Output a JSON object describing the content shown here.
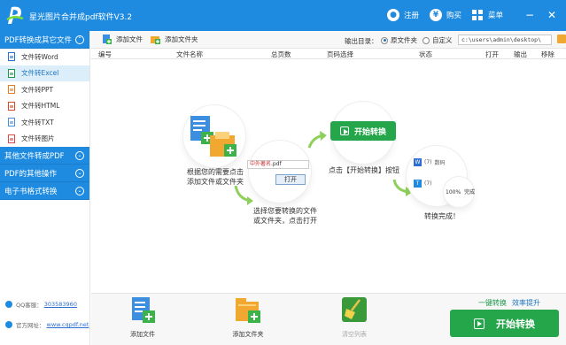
{
  "app": {
    "title": "星光图片合并成pdf软件V3.2",
    "logo_letter": "P"
  },
  "titlebar": {
    "register_label": "注册",
    "buy_label": "购买",
    "menu_label": "菜单",
    "minimize": "−",
    "close": "✕"
  },
  "sidebar": {
    "categories": [
      {
        "label": "PDF转换成其它文件",
        "chevron": "⌃"
      },
      {
        "label": "其他文件转成PDF",
        "chevron": "⌄"
      },
      {
        "label": "PDF的其他操作",
        "chevron": "⌄"
      },
      {
        "label": "电子书格式转换",
        "chevron": "⌄"
      }
    ],
    "items": [
      {
        "label": "文件转Word"
      },
      {
        "label": "文件转Excel"
      },
      {
        "label": "文件转PPT"
      },
      {
        "label": "文件转HTML"
      },
      {
        "label": "文件转TXT"
      },
      {
        "label": "文件转图片"
      }
    ],
    "qq_label": "QQ客服：",
    "qq_value": "303583960",
    "site_label": "官方网址：",
    "site_value": "www.cqpdf.net"
  },
  "toolbar": {
    "add_file": "添加文件",
    "add_folder": "添加文件夹",
    "output_label": "输出目录：",
    "radio_original": "原文件夹",
    "radio_custom": "自定义",
    "output_path": "c:\\users\\admin\\desktop\\"
  },
  "table": {
    "columns": [
      "编号",
      "文件名称",
      "总页数",
      "页码选择",
      "状态",
      "打开",
      "输出",
      "移除"
    ]
  },
  "guide": {
    "step1": "根据您的需要点击添加文件或文件夹",
    "step1_line1": "根据您的需要点击",
    "step1_line2": "添加文件或文件夹",
    "step2_line1": "选择您要转换的文件",
    "step2_line2": "或文件夹，点击打开",
    "step3": "点击【开始转换】按钮",
    "step4": "转换完成！",
    "convert_btn": "开始转换",
    "dialog_filename": "中外著名",
    "dialog_ext": ".pdf",
    "dialog_open": "打开",
    "progress": "100%",
    "done": "完成",
    "num": "(7)",
    "num_suffix": "数码"
  },
  "bottom": {
    "add_file": "添加文件",
    "add_folder": "添加文件夹",
    "clear_list": "清空列表",
    "promo_a": "一键转换",
    "promo_b": "效率提升",
    "start": "开始转换"
  },
  "colors": {
    "primary": "#1e8be0",
    "green": "#26a64a",
    "sidebar_active": "#dbeefa"
  }
}
